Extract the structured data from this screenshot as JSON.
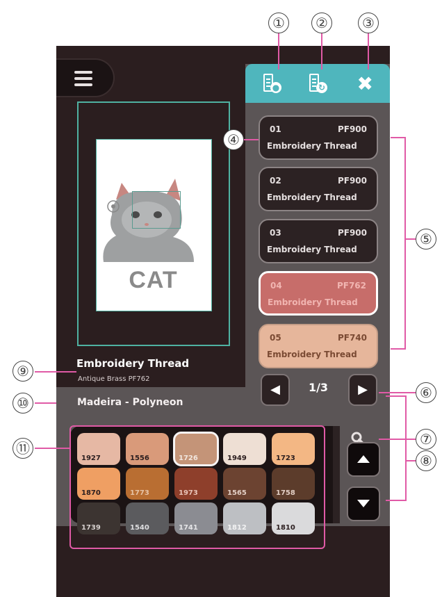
{
  "callouts": [
    "①",
    "②",
    "③",
    "④",
    "⑤",
    "⑥",
    "⑦",
    "⑧",
    "⑨",
    "⑩",
    "⑪"
  ],
  "thread_list": [
    {
      "num": "01",
      "code": "PF900",
      "name": "Embroidery Thread",
      "color": "#2c2223"
    },
    {
      "num": "02",
      "code": "PF900",
      "name": "Embroidery Thread",
      "color": "#2c2223"
    },
    {
      "num": "03",
      "code": "PF900",
      "name": "Embroidery Thread",
      "color": "#2c2223"
    },
    {
      "num": "04",
      "code": "PF762",
      "name": "Embroidery Thread",
      "color": "#c76d6a"
    },
    {
      "num": "05",
      "code": "PF740",
      "name": "Embroidery Thread",
      "color": "#e6b69b"
    }
  ],
  "selected_thread": {
    "title": "Embroidery Thread",
    "subtitle": "Antique Brass PF762"
  },
  "brand": "Madeira - Polyneon",
  "pager": {
    "label": "1/3"
  },
  "design": {
    "text": "CAT"
  },
  "palette": [
    {
      "code": "1927",
      "color": "#e6b8a4"
    },
    {
      "code": "1556",
      "color": "#d99a7a"
    },
    {
      "code": "1726",
      "color": "#c49478",
      "selected": true
    },
    {
      "code": "1949",
      "color": "#eedfd4"
    },
    {
      "code": "1723",
      "color": "#f3b784"
    },
    {
      "code": "1870",
      "color": "#ef9f63"
    },
    {
      "code": "1773",
      "color": "#b96e32"
    },
    {
      "code": "1973",
      "color": "#8e3f2b"
    },
    {
      "code": "1565",
      "color": "#6c4331"
    },
    {
      "code": "1758",
      "color": "#5c3c2b"
    },
    {
      "code": "1739",
      "color": "#3c3431"
    },
    {
      "code": "1540",
      "color": "#5b5b5e"
    },
    {
      "code": "1741",
      "color": "#8b8c92"
    },
    {
      "code": "1812",
      "color": "#bdbfc3"
    },
    {
      "code": "1810",
      "color": "#dadadc"
    }
  ],
  "icons": {
    "menu": "menu-icon",
    "apply": "thread-apply-icon",
    "replace": "thread-replace-icon",
    "close": "close-icon",
    "search": "search-icon"
  },
  "colors": {
    "accent": "#4fb6bd",
    "screen_bg": "#2b1e1f",
    "panel": "#5b5556",
    "callout_line": "#e05aa6"
  }
}
